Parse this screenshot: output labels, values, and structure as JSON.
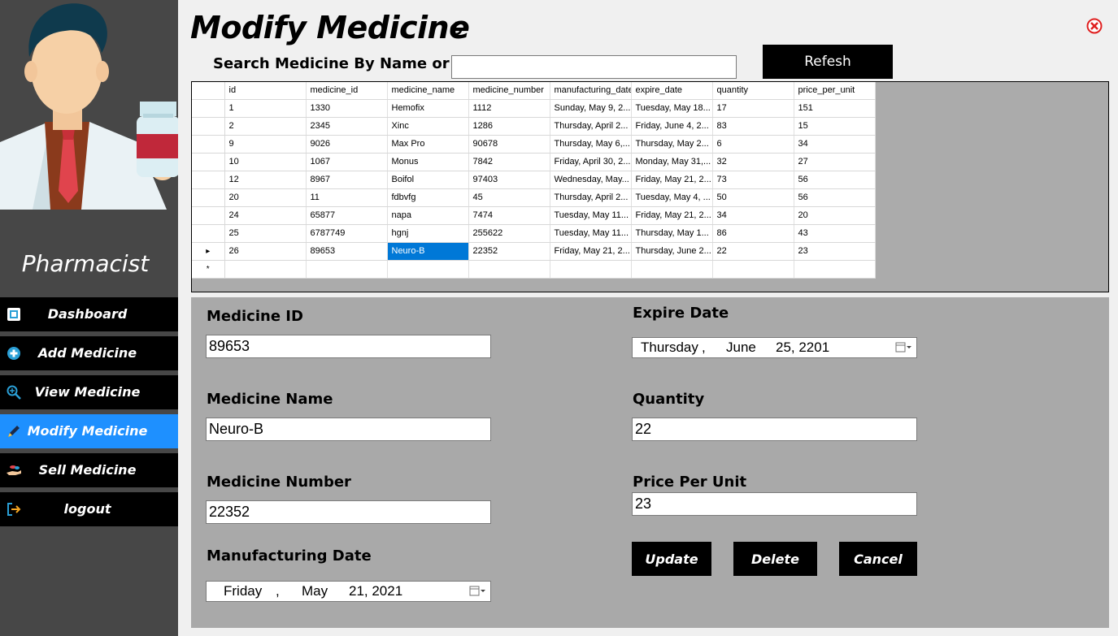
{
  "sidebar": {
    "role": "Pharmacist",
    "items": [
      {
        "label": "Dashboard"
      },
      {
        "label": "Add Medicine"
      },
      {
        "label": "View Medicine"
      },
      {
        "label": "Modify Medicine"
      },
      {
        "label": "Sell Medicine"
      },
      {
        "label": "logout"
      }
    ],
    "active_index": 3,
    "active_color": "#1e90ff"
  },
  "header": {
    "title": "Modify Medicine",
    "search_label": "Search Medicine By Name or ID",
    "search_value": "",
    "refresh_label": "Refesh"
  },
  "grid": {
    "columns": [
      "id",
      "medicine_id",
      "medicine_name",
      "medicine_number",
      "manufacturing_date",
      "expire_date",
      "quantity",
      "price_per_unit"
    ],
    "rows": [
      [
        "1",
        "1330",
        "Hemofix",
        "1112",
        "Sunday, May 9, 2...",
        "Tuesday, May 18...",
        "17",
        "151"
      ],
      [
        "2",
        "2345",
        "Xinc",
        "1286",
        "Thursday, April 2...",
        "Friday, June 4, 2...",
        "83",
        "15"
      ],
      [
        "9",
        "9026",
        "Max Pro",
        "90678",
        "Thursday, May 6,...",
        "Thursday, May 2...",
        "6",
        "34"
      ],
      [
        "10",
        "1067",
        "Monus",
        "7842",
        "Friday, April 30, 2...",
        "Monday, May 31,...",
        "32",
        "27"
      ],
      [
        "12",
        "8967",
        "Boifol",
        "97403",
        "Wednesday, May...",
        "Friday, May 21, 2...",
        "73",
        "56"
      ],
      [
        "20",
        "11",
        "fdbvfg",
        "45",
        "Thursday, April 2...",
        "Tuesday, May 4, ...",
        "50",
        "56"
      ],
      [
        "24",
        "65877",
        "napa",
        "7474",
        "Tuesday, May 11...",
        "Friday, May 21, 2...",
        "34",
        "20"
      ],
      [
        "25",
        "6787749",
        "hgnj",
        "255622",
        "Tuesday, May 11...",
        "Thursday, May 1...",
        "86",
        "43"
      ],
      [
        "26",
        "89653",
        "Neuro-B",
        "22352",
        "Friday, May 21, 2...",
        "Thursday, June 2...",
        "22",
        "23"
      ]
    ],
    "current_row_marker": "▸",
    "new_row_marker": "*",
    "selected_color": "#0078d7"
  },
  "form": {
    "medicine_id": {
      "label": "Medicine ID",
      "value": "89653"
    },
    "medicine_name": {
      "label": "Medicine Name",
      "value": "Neuro-B"
    },
    "medicine_number": {
      "label": "Medicine Number",
      "value": "22352"
    },
    "manufacturing_date": {
      "label": "Manufacturing Date",
      "day": "Friday",
      "sep": ",",
      "month": "May",
      "date": "21, 2021"
    },
    "expire_date": {
      "label": "Expire Date",
      "day": "Thursday",
      "sep": ",",
      "month": "June",
      "date": "25, 2201"
    },
    "quantity": {
      "label": "Quantity",
      "value": "22"
    },
    "price_per_unit": {
      "label": "Price Per Unit",
      "value": "23"
    }
  },
  "actions": {
    "update": "Update",
    "delete": "Delete",
    "cancel": "Cancel"
  },
  "icons": {
    "refresh": "refresh-icon",
    "close": "close-icon",
    "nav": [
      "dashboard-icon",
      "add-icon",
      "magnifier-icon",
      "pen-icon",
      "hand-pills-icon",
      "logout-icon"
    ]
  }
}
